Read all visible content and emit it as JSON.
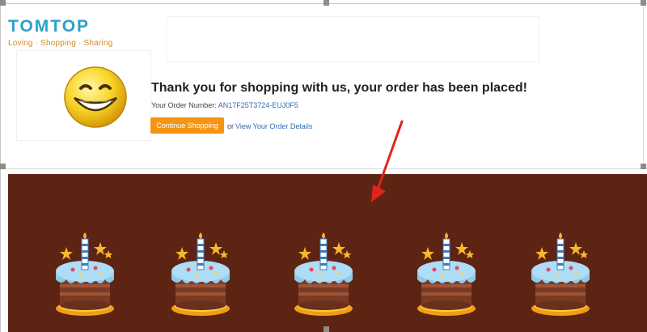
{
  "brand": {
    "name": "TOMTOP",
    "tagline": "Loving · Shopping · Sharing",
    "color": "#2aa2c8",
    "tagline_color": "#d3892a"
  },
  "confirmation": {
    "title": "Thank you for shopping with us, your order has been placed!",
    "order_label": "Your Order Number: ",
    "order_number": "AN17F25T3724-EUJ0F5",
    "continue_label": "Continue Shopping",
    "or_label": "or",
    "details_link": "View Your Order Details"
  },
  "banner": {
    "background": "#5d2414",
    "cake_count": 5,
    "icon": "birthday-cake-icon"
  },
  "annotation": {
    "icon": "red-arrow-icon",
    "color": "#e2231a"
  },
  "colors": {
    "button": "#f59412",
    "link": "#2f6cb3"
  }
}
